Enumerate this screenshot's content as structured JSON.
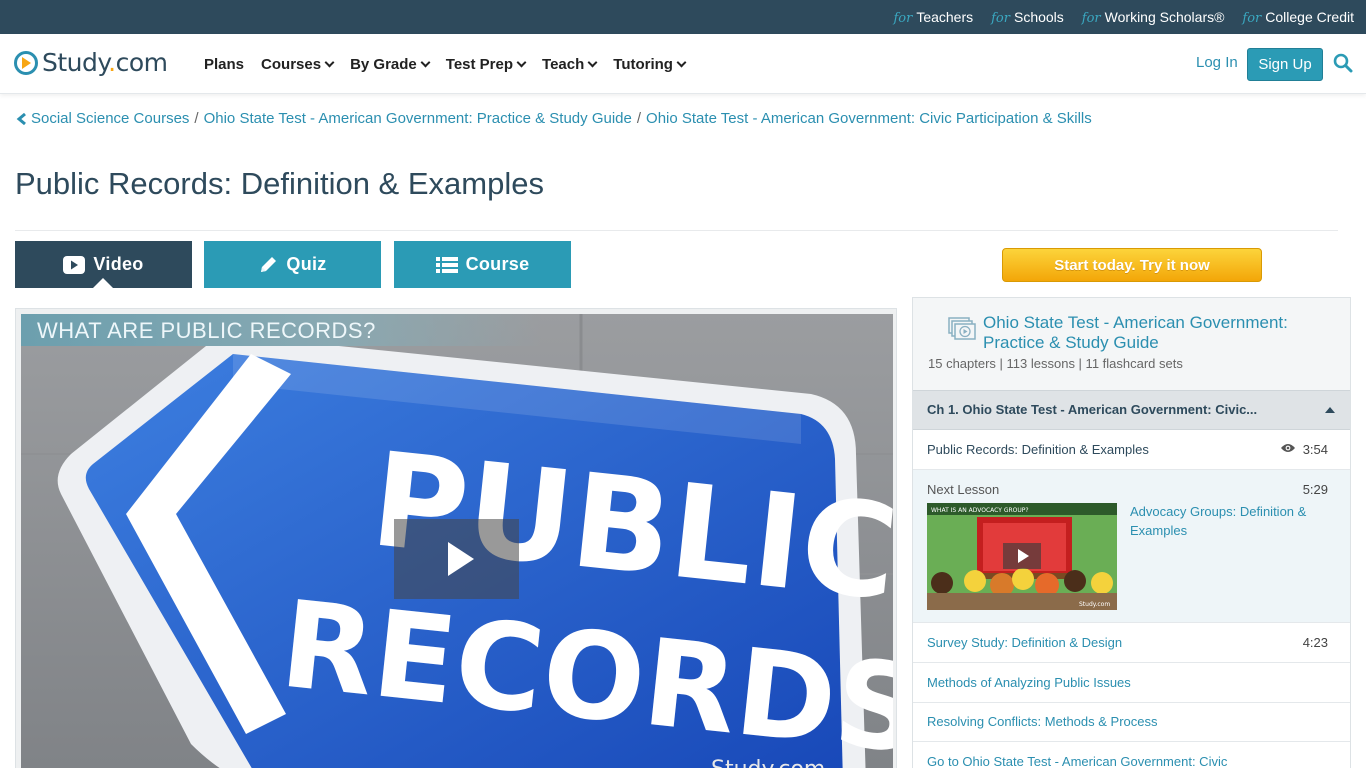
{
  "topbar": {
    "links": [
      {
        "prefix": "for",
        "label": "Teachers"
      },
      {
        "prefix": "for",
        "label": "Schools"
      },
      {
        "prefix": "for",
        "label": "Working Scholars®"
      },
      {
        "prefix": "for",
        "label": "College Credit"
      }
    ]
  },
  "header": {
    "logo": {
      "part1": "Study",
      "dot": ".",
      "part2": "com"
    },
    "nav": [
      "Plans",
      "Courses",
      "By Grade",
      "Test Prep",
      "Teach",
      "Tutoring"
    ],
    "login": "Log In",
    "signup": "Sign Up",
    "search_icon": "search-icon"
  },
  "breadcrumb": {
    "items": [
      "Social Science Courses",
      "Ohio State Test - American Government: Practice & Study Guide",
      "Ohio State Test - American Government: Civic Participation & Skills"
    ],
    "separator": "/"
  },
  "page_title": "Public Records: Definition & Examples",
  "tabs": {
    "video": "Video",
    "quiz": "Quiz",
    "course": "Course"
  },
  "video": {
    "banner": "WHAT ARE PUBLIC RECORDS?",
    "sign_line1": "PUBLIC",
    "sign_line2": "RECORDS",
    "watermark": "Study.com"
  },
  "sidebar": {
    "cta": "Start today. Try it now",
    "course_title": "Ohio State Test - American Government: Practice & Study Guide",
    "course_meta": "15 chapters | 113 lessons | 11 flashcard sets",
    "chapter": "Ch 1. Ohio State Test - American Government: Civic...",
    "current_lesson": {
      "title": "Public Records: Definition & Examples",
      "duration": "3:54"
    },
    "next_lesson": {
      "label": "Next Lesson",
      "duration": "5:29",
      "title": "Advocacy Groups: Definition & Examples",
      "thumb_caption": "WHAT IS AN ADVOCACY GROUP?"
    },
    "lessons": [
      {
        "title": "Survey Study: Definition & Design",
        "duration": "4:23"
      },
      {
        "title": "Methods of Analyzing Public Issues",
        "duration": ""
      },
      {
        "title": "Resolving Conflicts: Methods & Process",
        "duration": ""
      }
    ],
    "go_to": {
      "prefix": "Go to",
      "target": "Ohio State Test - American Government: Civic"
    }
  },
  "colors": {
    "navy": "#2e4a5c",
    "teal": "#2b9bb5",
    "link": "#2b8fb0",
    "orange": "#f7a614"
  }
}
